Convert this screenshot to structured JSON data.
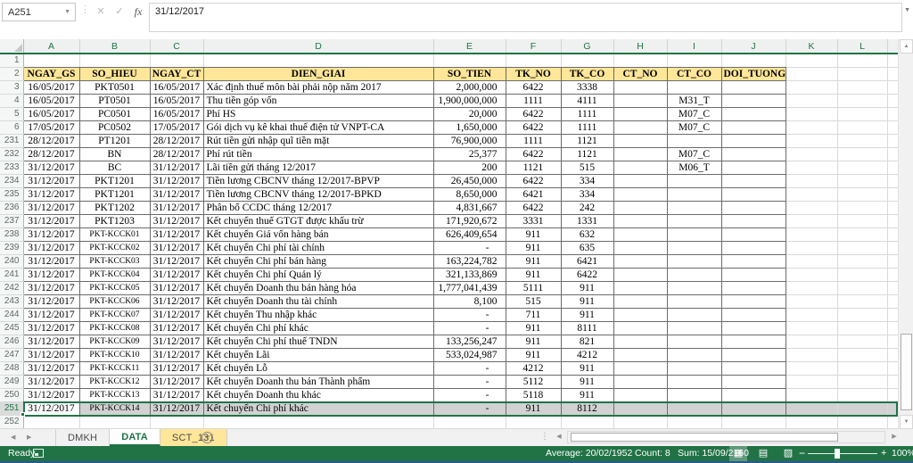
{
  "formula_bar": {
    "name_box_value": "A251",
    "cancel_label": "✕",
    "enter_label": "✓",
    "fx_label": "fx",
    "formula_value": "31/12/2017"
  },
  "grid": {
    "column_letters": [
      "A",
      "B",
      "C",
      "D",
      "E",
      "F",
      "G",
      "H",
      "I",
      "J",
      "K",
      "L"
    ],
    "selected_cell": "A251",
    "selected_row": 251,
    "rows": [
      {
        "n": "1",
        "type": "b"
      },
      {
        "n": "2",
        "type": "h",
        "cells": [
          "NGAY_GS",
          "SO_HIEU",
          "NGAY_CT",
          "DIEN_GIAI",
          "SO_TIEN",
          "TK_NO",
          "TK_CO",
          "CT_NO",
          "CT_CO",
          "DOI_TUONG"
        ]
      },
      {
        "n": "3",
        "type": "d",
        "cells": [
          "16/05/2017",
          "PKT0501",
          "16/05/2017",
          "Xác định thuế môn bài phải nộp năm 2017",
          "2,000,000",
          "6422",
          "3338",
          "",
          "",
          ""
        ]
      },
      {
        "n": "4",
        "type": "d",
        "cells": [
          "16/05/2017",
          "PT0501",
          "16/05/2017",
          "Thu tiền góp vốn",
          "1,900,000,000",
          "1111",
          "4111",
          "",
          "M31_T",
          ""
        ]
      },
      {
        "n": "5",
        "type": "d",
        "cells": [
          "16/05/2017",
          "PC0501",
          "16/05/2017",
          "Phí HS",
          "20,000",
          "6422",
          "1111",
          "",
          "M07_C",
          ""
        ]
      },
      {
        "n": "6",
        "type": "d",
        "cells": [
          "17/05/2017",
          "PC0502",
          "17/05/2017",
          "Gói dịch vụ kê khai thuế điện tử VNPT-CA",
          "1,650,000",
          "6422",
          "1111",
          "",
          "M07_C",
          ""
        ]
      },
      {
        "n": "231",
        "type": "d",
        "cells": [
          "28/12/2017",
          "PT1201",
          "28/12/2017",
          "Rút tiền gửi nhập quĩ tiền mặt",
          "76,900,000",
          "1111",
          "1121",
          "",
          "",
          ""
        ]
      },
      {
        "n": "232",
        "type": "d",
        "cells": [
          "28/12/2017",
          "BN",
          "28/12/2017",
          "Phí rút tiền",
          "25,377",
          "6422",
          "1121",
          "",
          "M07_C",
          ""
        ]
      },
      {
        "n": "233",
        "type": "d",
        "cells": [
          "31/12/2017",
          "BC",
          "31/12/2017",
          "Lãi tiền gửi tháng 12/2017",
          "200",
          "1121",
          "515",
          "",
          "M06_T",
          ""
        ]
      },
      {
        "n": "234",
        "type": "d",
        "cells": [
          "31/12/2017",
          "PKT1201",
          "31/12/2017",
          "Tiền lương CBCNV tháng 12/2017-BPVP",
          "26,450,000",
          "6422",
          "334",
          "",
          "",
          ""
        ]
      },
      {
        "n": "235",
        "type": "d",
        "cells": [
          "31/12/2017",
          "PKT1201",
          "31/12/2017",
          "Tiền lương CBCNV tháng 12/2017-BPKD",
          "8,650,000",
          "6421",
          "334",
          "",
          "",
          ""
        ]
      },
      {
        "n": "236",
        "type": "d",
        "cells": [
          "31/12/2017",
          "PKT1202",
          "31/12/2017",
          "Phân bổ CCDC tháng 12/2017",
          "4,831,667",
          "6422",
          "242",
          "",
          "",
          ""
        ]
      },
      {
        "n": "237",
        "type": "d",
        "cells": [
          "31/12/2017",
          "PKT1203",
          "31/12/2017",
          "Kết chuyển thuế GTGT được khấu trừ",
          "171,920,672",
          "3331",
          "1331",
          "",
          "",
          ""
        ]
      },
      {
        "n": "238",
        "type": "d",
        "cells": [
          "31/12/2017",
          "PKT-KCCK01",
          "31/12/2017",
          "Kết chuyển Giá vốn hàng bán",
          "626,409,654",
          "911",
          "632",
          "",
          "",
          ""
        ]
      },
      {
        "n": "239",
        "type": "d",
        "cells": [
          "31/12/2017",
          "PKT-KCCK02",
          "31/12/2017",
          "Kết chuyển Chi phí tài chính",
          "-",
          "911",
          "635",
          "",
          "",
          ""
        ]
      },
      {
        "n": "240",
        "type": "d",
        "cells": [
          "31/12/2017",
          "PKT-KCCK03",
          "31/12/2017",
          "Kết chuyển Chi phí bán hàng",
          "163,224,782",
          "911",
          "6421",
          "",
          "",
          ""
        ]
      },
      {
        "n": "241",
        "type": "d",
        "cells": [
          "31/12/2017",
          "PKT-KCCK04",
          "31/12/2017",
          "Kết chuyển Chi phí Quản lý",
          "321,133,869",
          "911",
          "6422",
          "",
          "",
          ""
        ]
      },
      {
        "n": "242",
        "type": "d",
        "cells": [
          "31/12/2017",
          "PKT-KCCK05",
          "31/12/2017",
          "Kết chuyển Doanh thu bán hàng hóa",
          "1,777,041,439",
          "5111",
          "911",
          "",
          "",
          ""
        ]
      },
      {
        "n": "243",
        "type": "d",
        "cells": [
          "31/12/2017",
          "PKT-KCCK06",
          "31/12/2017",
          "Kết chuyển Doanh thu tài chính",
          "8,100",
          "515",
          "911",
          "",
          "",
          ""
        ]
      },
      {
        "n": "244",
        "type": "d",
        "cells": [
          "31/12/2017",
          "PKT-KCCK07",
          "31/12/2017",
          "Kết chuyển Thu nhập khác",
          "-",
          "711",
          "911",
          "",
          "",
          ""
        ]
      },
      {
        "n": "245",
        "type": "d",
        "cells": [
          "31/12/2017",
          "PKT-KCCK08",
          "31/12/2017",
          "Kết chuyển Chi phí khác",
          "-",
          "911",
          "8111",
          "",
          "",
          ""
        ]
      },
      {
        "n": "246",
        "type": "d",
        "cells": [
          "31/12/2017",
          "PKT-KCCK09",
          "31/12/2017",
          "Kết chuyển Chi phí thuế TNDN",
          "133,256,247",
          "911",
          "821",
          "",
          "",
          ""
        ]
      },
      {
        "n": "247",
        "type": "d",
        "cells": [
          "31/12/2017",
          "PKT-KCCK10",
          "31/12/2017",
          "Kết chuyển Lãi",
          "533,024,987",
          "911",
          "4212",
          "",
          "",
          ""
        ]
      },
      {
        "n": "248",
        "type": "d",
        "cells": [
          "31/12/2017",
          "PKT-KCCK11",
          "31/12/2017",
          "Kết chuyển Lỗ",
          "-",
          "4212",
          "911",
          "",
          "",
          ""
        ]
      },
      {
        "n": "249",
        "type": "d",
        "cells": [
          "31/12/2017",
          "PKT-KCCK12",
          "31/12/2017",
          "Kết chuyển Doanh thu bán Thành phẩm",
          "-",
          "5112",
          "911",
          "",
          "",
          ""
        ]
      },
      {
        "n": "250",
        "type": "d",
        "cells": [
          "31/12/2017",
          "PKT-KCCK13",
          "31/12/2017",
          "Kết chuyển Doanh thu khác",
          "-",
          "5118",
          "911",
          "",
          "",
          ""
        ]
      },
      {
        "n": "251",
        "type": "d",
        "selected": true,
        "cells": [
          "31/12/2017",
          "PKT-KCCK14",
          "31/12/2017",
          "Kết chuyển Chi phí khác",
          "-",
          "911",
          "8112",
          "",
          "",
          ""
        ]
      },
      {
        "n": "252",
        "type": "b"
      }
    ]
  },
  "sheet_tabs": {
    "tabs": [
      {
        "label": "DMKH",
        "state": "normal"
      },
      {
        "label": "DATA",
        "state": "active"
      },
      {
        "label": "SCT_131",
        "state": "colored"
      }
    ],
    "add_sheet_label": "+"
  },
  "status_bar": {
    "mode": "Ready",
    "average": "Average: 20/02/1952",
    "count": "Count: 8",
    "sum": "Sum: 15/09/2160",
    "zoom_out_label": "−",
    "zoom_in_label": "+",
    "zoom_level": "100%"
  },
  "colors": {
    "accent_green": "#217346",
    "header_fill": "#ffe699",
    "selection_fill": "#d2d2d2",
    "table_border": "#6b6b6b",
    "gridline": "#d9d9d9",
    "tab_color_fill": "#ffe699",
    "window_edge_blue": "#2b5797"
  }
}
